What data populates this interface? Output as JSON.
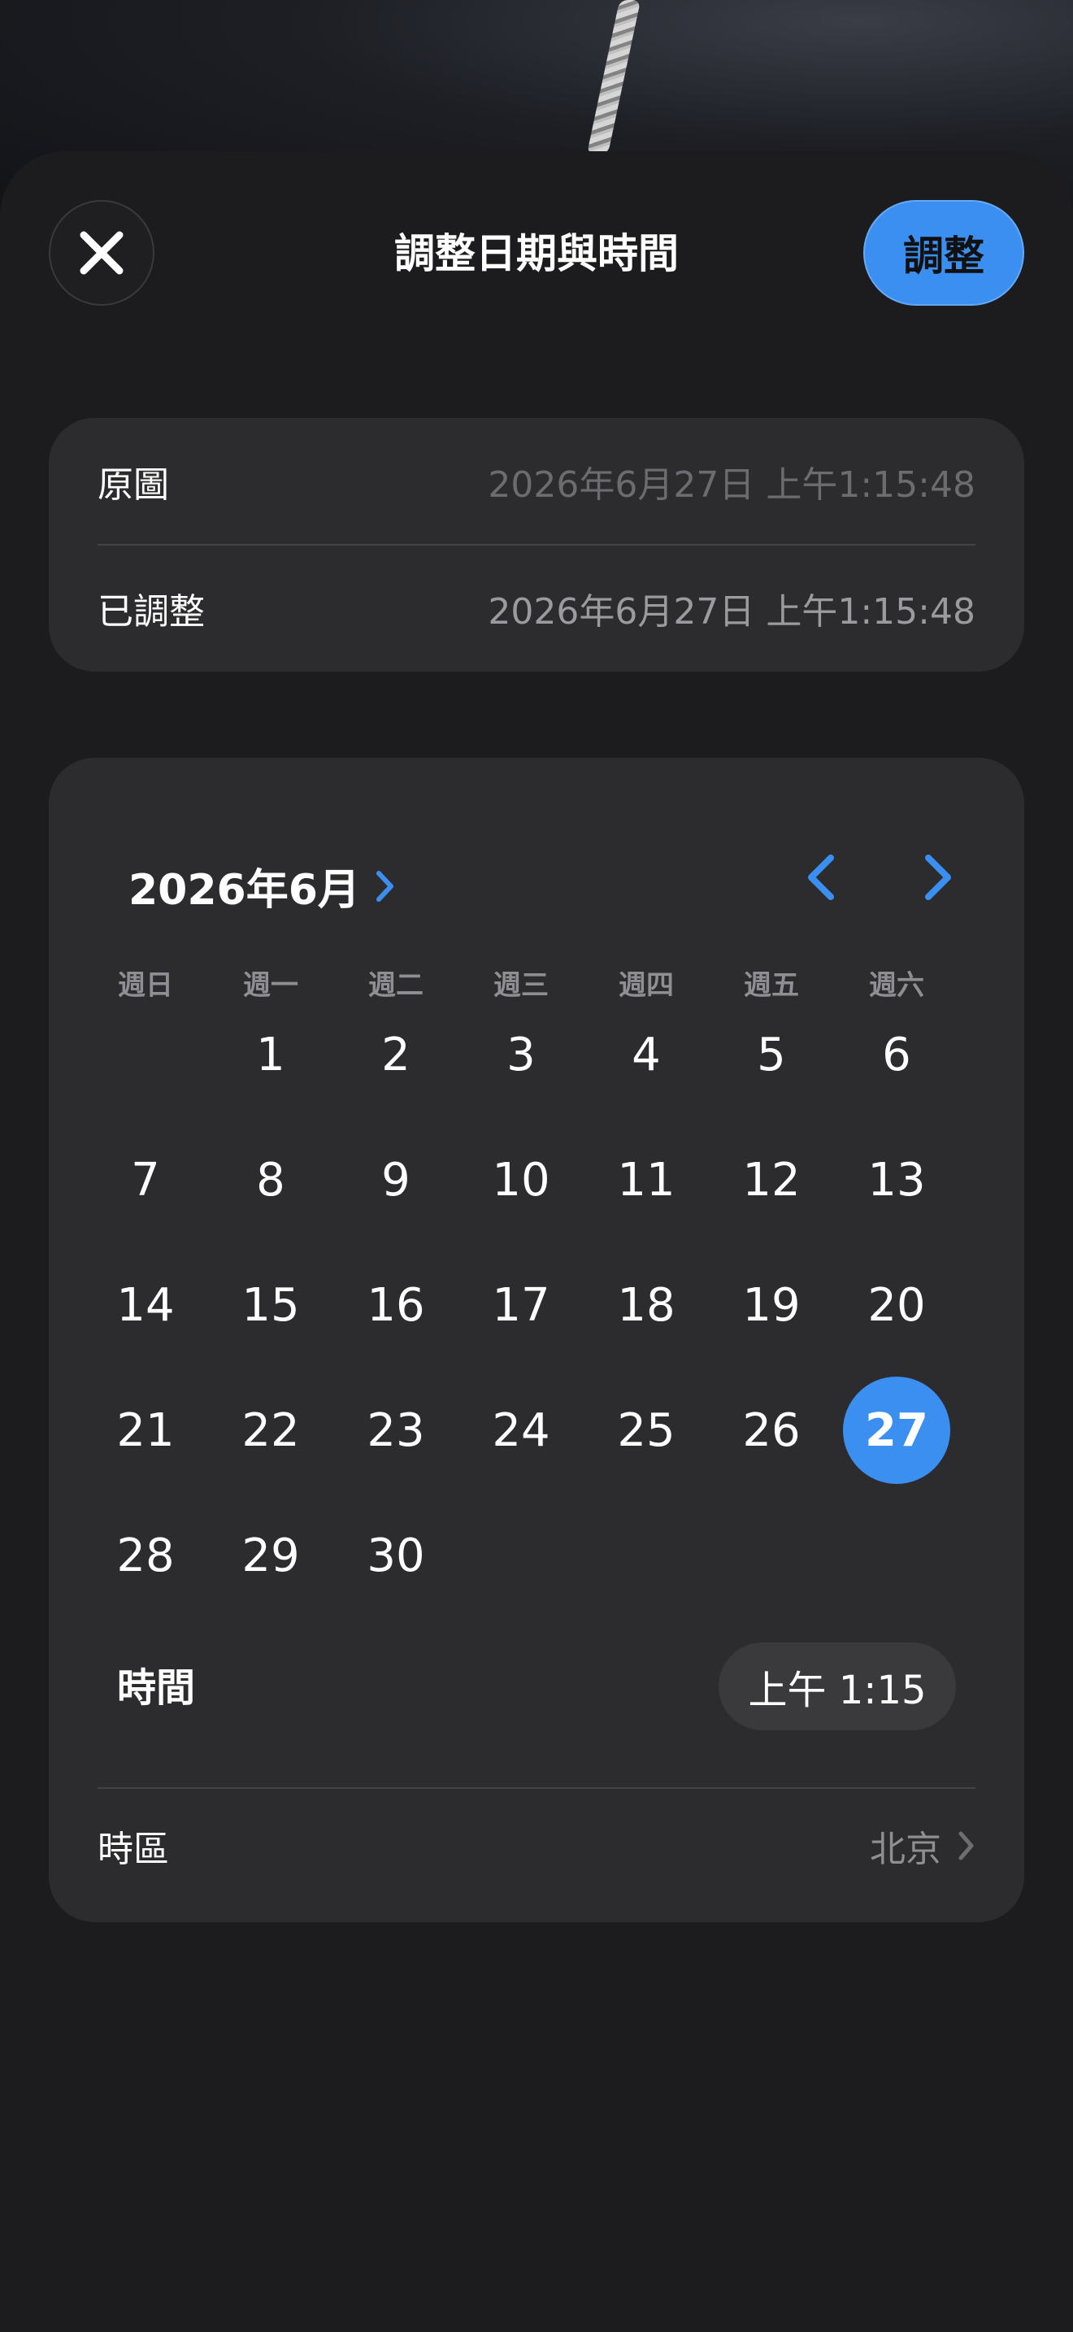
{
  "header": {
    "title": "調整日期與時間",
    "adjust_label": "調整",
    "close_icon": "close-icon"
  },
  "summary": {
    "original_label": "原圖",
    "original_value": "2026年6月27日 上午1:15:48",
    "adjusted_label": "已調整",
    "adjusted_value": "2026年6月27日 上午1:15:48"
  },
  "calendar": {
    "month_label": "2026年6月",
    "weekdays": [
      "週日",
      "週一",
      "週二",
      "週三",
      "週四",
      "週五",
      "週六"
    ],
    "leading_blanks": 1,
    "days": [
      "1",
      "2",
      "3",
      "4",
      "5",
      "6",
      "7",
      "8",
      "9",
      "10",
      "11",
      "12",
      "13",
      "14",
      "15",
      "16",
      "17",
      "18",
      "19",
      "20",
      "21",
      "22",
      "23",
      "24",
      "25",
      "26",
      "27",
      "28",
      "29",
      "30"
    ],
    "selected_day": "27"
  },
  "time": {
    "label": "時間",
    "value": "上午 1:15"
  },
  "timezone": {
    "label": "時區",
    "value": "北京"
  },
  "colors": {
    "accent": "#3a8ff0",
    "card": "#2c2c2e",
    "background": "#1c1c1e"
  }
}
